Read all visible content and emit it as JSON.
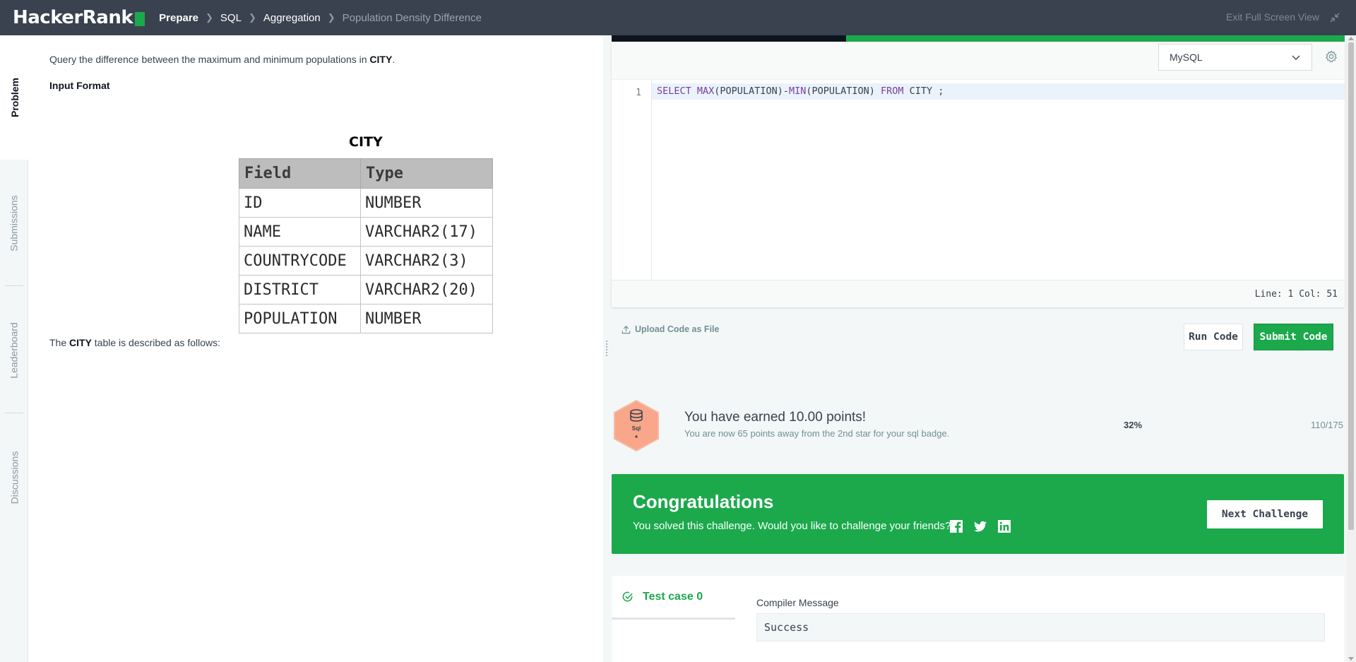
{
  "header": {
    "logo": "HackerRank",
    "breadcrumbs": [
      "Prepare",
      "SQL",
      "Aggregation",
      "Population Density Difference"
    ],
    "exit_fullscreen": "Exit Full Screen View"
  },
  "side_tabs": [
    "Problem",
    "Submissions",
    "Leaderboard",
    "Discussions"
  ],
  "problem": {
    "statement_prefix": "Query the difference between the maximum and minimum populations in ",
    "statement_table": "CITY",
    "statement_suffix": ".",
    "input_format": "Input Format",
    "described_prefix": "The ",
    "described_table": "CITY",
    "described_suffix": " table is described as follows:",
    "table_title": "CITY",
    "columns": [
      "Field",
      "Type"
    ],
    "rows": [
      [
        "ID",
        "NUMBER"
      ],
      [
        "NAME",
        "VARCHAR2(17)"
      ],
      [
        "COUNTRYCODE",
        "VARCHAR2(3)"
      ],
      [
        "DISTRICT",
        "VARCHAR2(20)"
      ],
      [
        "POPULATION",
        "NUMBER"
      ]
    ]
  },
  "editor": {
    "language": "MySQL",
    "line_number": "1",
    "code_tokens": [
      {
        "t": "SELECT ",
        "k": true
      },
      {
        "t": "MAX",
        "k": true
      },
      {
        "t": "(POPULATION)-",
        "k": false
      },
      {
        "t": "MIN",
        "k": true
      },
      {
        "t": "(POPULATION) ",
        "k": false
      },
      {
        "t": "FROM ",
        "k": true
      },
      {
        "t": "CITY ;",
        "k": false
      }
    ],
    "status": "Line: 1 Col: 51",
    "upload_label": "Upload Code as File",
    "run_label": "Run Code",
    "submit_label": "Submit Code"
  },
  "badge": {
    "label": "Sql",
    "title": "You have earned 10.00 points!",
    "subtitle": "You are now 65 points away from the 2nd star for your sql badge.",
    "percent": "32%",
    "progress": "110/175"
  },
  "congrats": {
    "title": "Congratulations",
    "message": "You solved this challenge. Would you like to challenge your friends?",
    "next_label": "Next Challenge"
  },
  "results": {
    "test_case": "Test case 0",
    "compiler_label": "Compiler Message",
    "compiler_output": "Success"
  },
  "colors": {
    "nav_bg": "#39424e",
    "brand_green": "#1ba94c",
    "badge_orange": "#f9a68a"
  }
}
